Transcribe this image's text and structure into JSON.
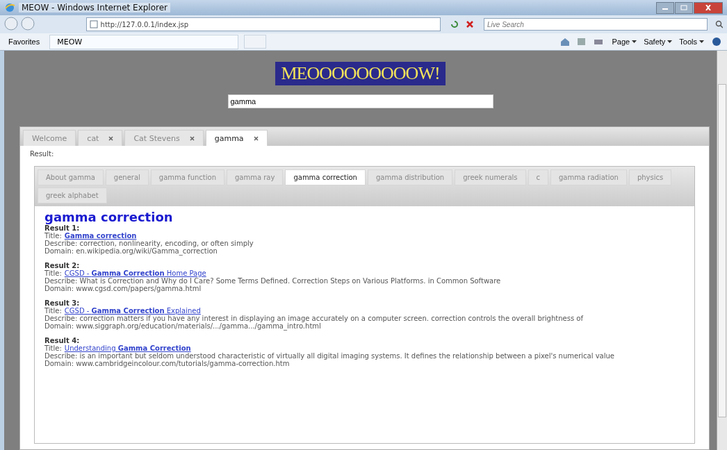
{
  "window": {
    "title": "MEOW - Windows Internet Explorer"
  },
  "address_bar": {
    "url": "http://127.0.0.1/index.jsp",
    "search_placeholder": "Live Search"
  },
  "favorites_bar": {
    "favorites": "Favorites",
    "tab": "MEOW",
    "menus": [
      "Page",
      "Safety",
      "Tools"
    ]
  },
  "page": {
    "logo": "MEOOOOOOOOOW!",
    "search_value": "gamma",
    "tabs": [
      {
        "label": "Welcome",
        "closable": false,
        "selected": false
      },
      {
        "label": "cat",
        "closable": true,
        "selected": false
      },
      {
        "label": "Cat Stevens",
        "closable": true,
        "selected": false
      },
      {
        "label": "gamma",
        "closable": true,
        "selected": true
      }
    ],
    "result_label": "Result:",
    "topic_tabs": [
      {
        "label": "About gamma",
        "selected": false
      },
      {
        "label": "general",
        "selected": false
      },
      {
        "label": "gamma function",
        "selected": false
      },
      {
        "label": "gamma ray",
        "selected": false
      },
      {
        "label": "gamma correction",
        "selected": true
      },
      {
        "label": "gamma distribution",
        "selected": false
      },
      {
        "label": "greek numerals",
        "selected": false
      },
      {
        "label": "c",
        "selected": false
      },
      {
        "label": "gamma radiation",
        "selected": false
      },
      {
        "label": "physics",
        "selected": false
      },
      {
        "label": "greek alphabet",
        "selected": false
      }
    ],
    "heading": "gamma correction",
    "results": [
      {
        "label": "Result 1:",
        "title_prefix": "Title:",
        "title": "**Gamma correction**",
        "describe": "Describe: correction, nonlinearity, encoding, or often simply",
        "domain": "Domain: en.wikipedia.org/wiki/Gamma_correction"
      },
      {
        "label": "Result 2:",
        "title_prefix": "Title:",
        "title": "CGSD - **Gamma Correction** Home Page",
        "describe": "Describe: What is Correction and Why do I Care? Some Terms Defined. Correction Steps on Various Platforms. in Common Software",
        "domain": "Domain: www.cgsd.com/papers/gamma.html"
      },
      {
        "label": "Result 3:",
        "title_prefix": "Title:",
        "title": "CGSD - **Gamma Correction** Explained",
        "describe": "Describe: correction matters if you have any interest in displaying an image accurately on a computer screen. correction controls the overall brightness of",
        "domain": "Domain: www.siggraph.org/education/materials/.../gamma.../gamma_intro.html"
      },
      {
        "label": "Result 4:",
        "title_prefix": "Title:",
        "title": "Understanding **Gamma Correction**",
        "describe": "Describe: is an important but seldom understood characteristic of virtually all digital imaging systems. It defines the relationship between a pixel's numerical value",
        "domain": "Domain: www.cambridgeincolour.com/tutorials/gamma-correction.htm"
      }
    ]
  }
}
